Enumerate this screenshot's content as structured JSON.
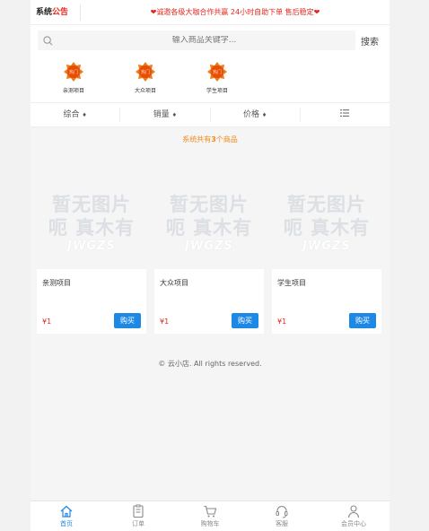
{
  "notice": {
    "title_a": "系统",
    "title_b": "公告",
    "text": "❤诚邀各级大咖合作共赢 24小时自助下单 售后稳定❤"
  },
  "search": {
    "placeholder": "输入商品关键字...",
    "button": "搜索"
  },
  "categories": [
    {
      "label": "亲测项目",
      "badge": "热门"
    },
    {
      "label": "大众项目",
      "badge": "热门"
    },
    {
      "label": "学生项目",
      "badge": "热门"
    }
  ],
  "sort": {
    "overall": "综合",
    "sales": "销量",
    "price": "价格",
    "arrow": "♦",
    "list_icon": "list-icon"
  },
  "count": {
    "prefix": "系统共有",
    "num": "3",
    "suffix": "个商品"
  },
  "placeholder_image": {
    "line1": "暂无图片",
    "line2": "呃 真木有",
    "line3": "JWGZS"
  },
  "products": [
    {
      "name": "亲测项目",
      "price": "¥1",
      "buy": "购买"
    },
    {
      "name": "大众项目",
      "price": "¥1",
      "buy": "购买"
    },
    {
      "name": "学生项目",
      "price": "¥1",
      "buy": "购买"
    }
  ],
  "copyright": "© 云小店. All rights reserved.",
  "nav": [
    {
      "label": "首页",
      "icon": "home-icon",
      "active": true
    },
    {
      "label": "订单",
      "icon": "order-icon",
      "active": false
    },
    {
      "label": "购物车",
      "icon": "cart-icon",
      "active": false
    },
    {
      "label": "客服",
      "icon": "headset-icon",
      "active": false
    },
    {
      "label": "会员中心",
      "icon": "user-icon",
      "active": false
    }
  ],
  "colors": {
    "accent": "#1e88e5",
    "notice_red": "#e6261b",
    "count_orange": "#f08a1c"
  }
}
